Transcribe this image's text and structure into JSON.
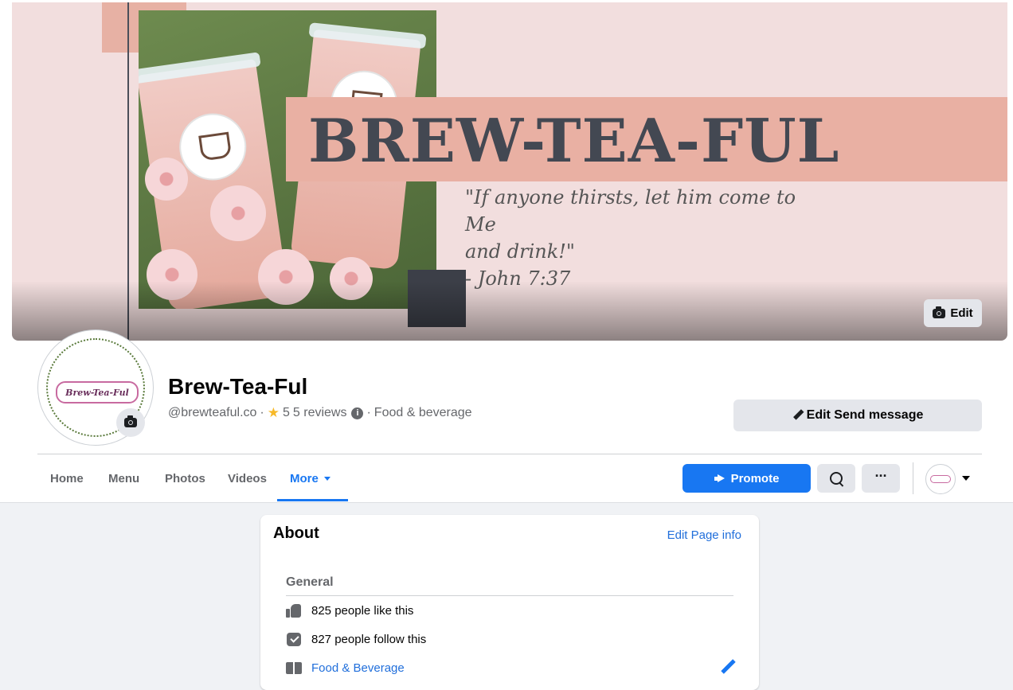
{
  "cover": {
    "brand_title": "BREW-TEA-FUL",
    "quote_lines": [
      "\"If anyone thirsts, let him come to Me",
      "and drink!\"",
      "- John 7:37"
    ],
    "edit_label": "Edit"
  },
  "profile": {
    "avatar_text": "Brew-Tea-Ful",
    "name": "Brew-Tea-Ful",
    "handle": "@brewteaful.co",
    "separator": "·",
    "rating": "5",
    "reviews": "5 reviews",
    "category": "Food & beverage"
  },
  "actions": {
    "edit_send_label": "Edit Send message"
  },
  "tabs": [
    {
      "label": "Home"
    },
    {
      "label": "Menu"
    },
    {
      "label": "Photos"
    },
    {
      "label": "Videos"
    },
    {
      "label": "More",
      "active": true
    }
  ],
  "toolbar": {
    "promote_label": "Promote",
    "more_dots": "···"
  },
  "about": {
    "title": "About",
    "edit_link": "Edit Page info",
    "section": "General",
    "likes": "825 people like this",
    "follows": "827 people follow this",
    "category_link": "Food & Beverage"
  },
  "colors": {
    "accent": "#1877f2",
    "cover_bg": "#f2dede",
    "brand_bar": "#e9b0a3",
    "brand_text": "#434852"
  },
  "icons": [
    "camera-icon",
    "star-icon",
    "info-icon",
    "pencil-icon",
    "caret-down-icon",
    "megaphone-icon",
    "search-icon",
    "more-dots-icon",
    "like-icon",
    "follow-icon",
    "category-icon"
  ]
}
